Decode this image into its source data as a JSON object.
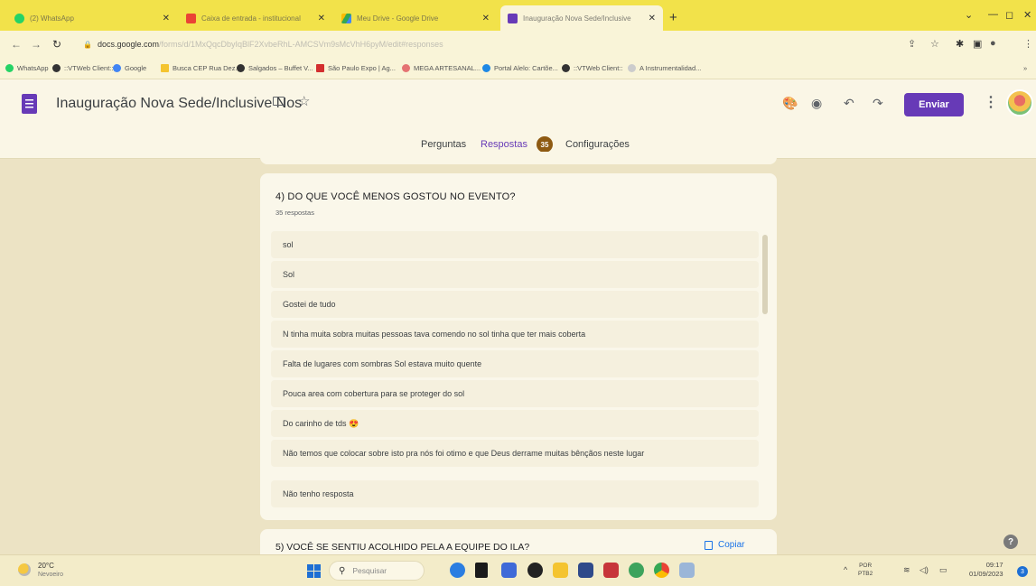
{
  "browser": {
    "tabs": [
      {
        "label": "(2) WhatsApp",
        "color": "#25d366"
      },
      {
        "label": "Caixa de entrada - institucional",
        "color": "#ea4335"
      },
      {
        "label": "Meu Drive - Google Drive",
        "color": "#fbbc04"
      },
      {
        "label": "Inauguração Nova Sede/Inclusive",
        "color": "#673ab7"
      }
    ],
    "new_tab": "+",
    "url_host": "docs.google.com",
    "url_path": "/forms/d/1MxQqcDbyIqBlF2XvbeRhL-AMCSVm9sMcVhH6pyM/edit#responses",
    "bookmarks": [
      "WhatsApp",
      "::VTWeb Client::",
      "Google",
      "Busca CEP Rua Dez...",
      "Salgados – Buffet V...",
      "São Paulo Expo | Ag...",
      "MEGA ARTESANAL...",
      "Portal Alelo: Cartõe...",
      "::VTWeb Client::",
      "A Instrumentalidad..."
    ]
  },
  "form": {
    "title": "Inauguração Nova Sede/Inclusive Nos",
    "send_label": "Enviar",
    "tabs": {
      "questions": "Perguntas",
      "responses": "Respostas",
      "responses_count": "35",
      "settings": "Configurações"
    }
  },
  "question": {
    "title": "4) DO QUE VOCÊ MENOS GOSTOU NO EVENTO?",
    "count": "35 respostas",
    "responses": [
      "sol",
      "Sol",
      "Gostei de tudo",
      "N tinha muita sobra muitas pessoas tava comendo no sol tinha que ter mais coberta",
      "Falta de lugares com sombras Sol estava muito quente",
      "Pouca area com cobertura para se proteger do sol",
      "Do carinho de tds 😍",
      "Não temos que colocar sobre isto pra nós foi otimo e que Deus derrame muitas bênçãos neste lugar",
      "Não tenho resposta"
    ]
  },
  "next_question": {
    "title": "5) VOCÊ SE SENTIU ACOLHIDO PELA A EQUIPE DO ILA?",
    "copy_label": "Copiar"
  },
  "taskbar": {
    "weather_temp": "20°C",
    "weather_desc": "Nevoeiro",
    "search_placeholder": "Pesquisar",
    "lang_line1": "POR",
    "lang_line2": "PTB2",
    "time": "09:17",
    "date": "01/09/2023",
    "notifications": "3"
  }
}
